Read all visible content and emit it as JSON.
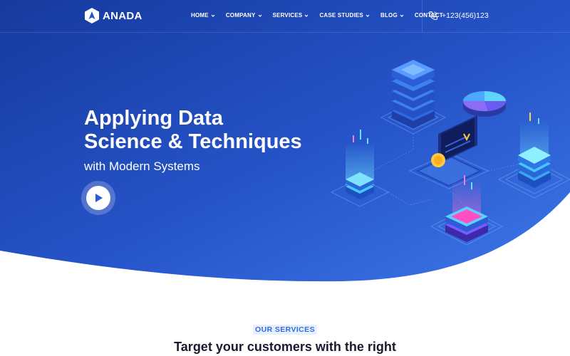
{
  "brand": {
    "name": "ANADA",
    "logo_icon": "hexagon-logo-icon"
  },
  "nav": {
    "items": [
      {
        "label": "HOME",
        "has_dropdown": true
      },
      {
        "label": "COMPANY",
        "has_dropdown": true
      },
      {
        "label": "SERVICES",
        "has_dropdown": true
      },
      {
        "label": "CASE STUDIES",
        "has_dropdown": true
      },
      {
        "label": "BLOG",
        "has_dropdown": true
      },
      {
        "label": "CONTACT",
        "has_dropdown": false
      }
    ],
    "phone": {
      "icon": "phone-icon",
      "number": "+123(456)123"
    }
  },
  "hero": {
    "title_lines": [
      "Applying Data",
      "Science & Techniques"
    ],
    "subtitle": "with Modern Systems",
    "play_icon": "play-icon"
  },
  "services": {
    "eyebrow": "OUR SERVICES",
    "title": "Target your customers with the right"
  },
  "colors": {
    "hero_gradient_start": "#1b3faa",
    "hero_gradient_end": "#3a74e6",
    "accent_blue": "#2f6ce0",
    "text_dark": "#1a1a2e",
    "white": "#ffffff"
  }
}
